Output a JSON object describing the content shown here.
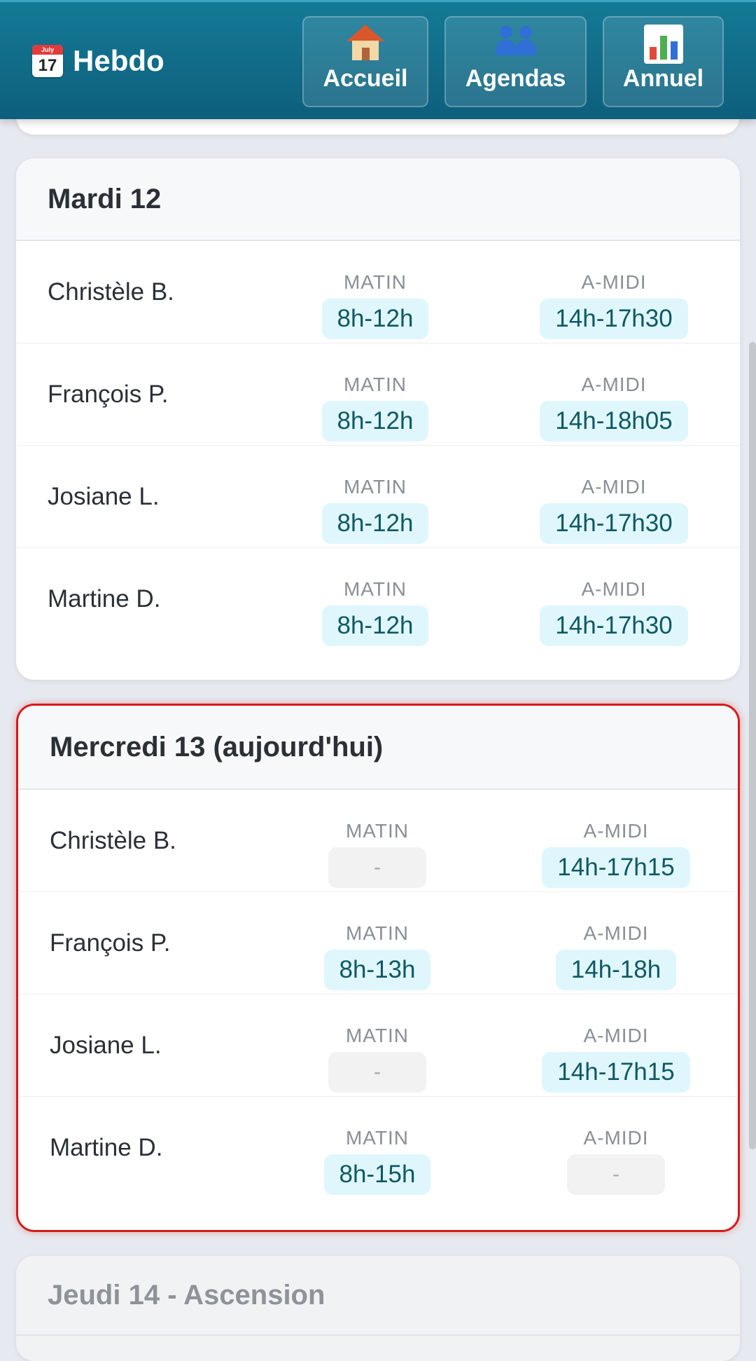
{
  "header": {
    "brand": "Hebdo",
    "calendar_month": "July",
    "calendar_day": "17",
    "nav": [
      {
        "label": "Accueil",
        "icon": "house-icon"
      },
      {
        "label": "Agendas",
        "icon": "people-icon"
      },
      {
        "label": "Annuel",
        "icon": "bar-chart-icon"
      }
    ]
  },
  "days": [
    {
      "title": "Mardi 12",
      "rows": [
        {
          "name": "Christèle B.",
          "am_label": "MATIN",
          "am": "8h-12h",
          "pm_label": "A-MIDI",
          "pm": "14h-17h30"
        },
        {
          "name": "François P.",
          "am_label": "MATIN",
          "am": "8h-12h",
          "pm_label": "A-MIDI",
          "pm": "14h-18h05"
        },
        {
          "name": "Josiane L.",
          "am_label": "MATIN",
          "am": "8h-12h",
          "pm_label": "A-MIDI",
          "pm": "14h-17h30"
        },
        {
          "name": "Martine D.",
          "am_label": "MATIN",
          "am": "8h-12h",
          "pm_label": "A-MIDI",
          "pm": "14h-17h30"
        }
      ]
    },
    {
      "title": "Mercredi 13 (aujourd'hui)",
      "is_today": true,
      "rows": [
        {
          "name": "Christèle B.",
          "am_label": "MATIN",
          "am": "-",
          "pm_label": "A-MIDI",
          "pm": "14h-17h15"
        },
        {
          "name": "François P.",
          "am_label": "MATIN",
          "am": "8h-13h",
          "pm_label": "A-MIDI",
          "pm": "14h-18h"
        },
        {
          "name": "Josiane L.",
          "am_label": "MATIN",
          "am": "-",
          "pm_label": "A-MIDI",
          "pm": "14h-17h15"
        },
        {
          "name": "Martine D.",
          "am_label": "MATIN",
          "am": "8h-15h",
          "pm_label": "A-MIDI",
          "pm": "-"
        }
      ]
    },
    {
      "title": "Jeudi 14 - Ascension",
      "is_holiday": true,
      "rows": []
    }
  ],
  "colors": {
    "header": "#147a96",
    "today_border": "#d51a1a",
    "pill_bg": "#dff7fc",
    "pill_text": "#0f5865",
    "empty_pill_bg": "#f2f2f2"
  }
}
